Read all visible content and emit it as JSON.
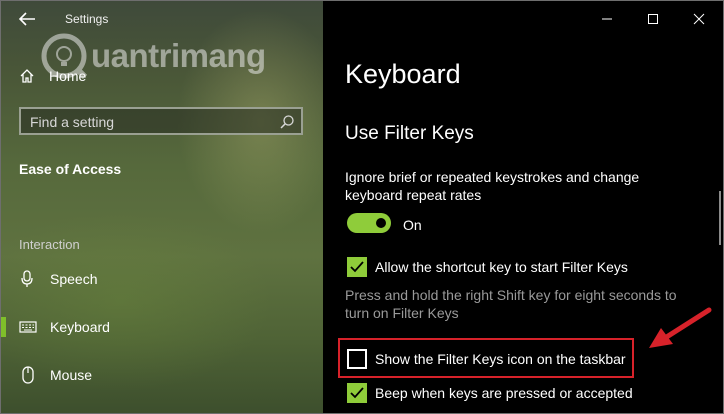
{
  "window": {
    "title": "Settings"
  },
  "watermark": {
    "text": "uantrimang"
  },
  "sidebar": {
    "home": "Home",
    "search_placeholder": "Find a setting",
    "section": "Ease of Access",
    "group": "Interaction",
    "items": [
      {
        "label": "Speech",
        "icon": "microphone-icon",
        "selected": false
      },
      {
        "label": "Keyboard",
        "icon": "keyboard-icon",
        "selected": true
      },
      {
        "label": "Mouse",
        "icon": "mouse-icon",
        "selected": false
      }
    ]
  },
  "main": {
    "title": "Keyboard",
    "subtitle": "Use Filter Keys",
    "description": "Ignore brief or repeated keystrokes and change keyboard repeat rates",
    "toggle": {
      "state": "On",
      "on": true
    },
    "options": [
      {
        "label": "Allow the shortcut key to start Filter Keys",
        "checked": true
      },
      {
        "label": "Show the Filter Keys icon on the taskbar",
        "checked": false
      },
      {
        "label": "Beep when keys are pressed or accepted",
        "checked": true
      }
    ],
    "hint": "Press and hold the right Shift key for eight seconds to turn on Filter Keys"
  },
  "colors": {
    "accent": "#8fcc3a",
    "highlight": "#d7222a",
    "hint_text": "#9a9a9a"
  }
}
